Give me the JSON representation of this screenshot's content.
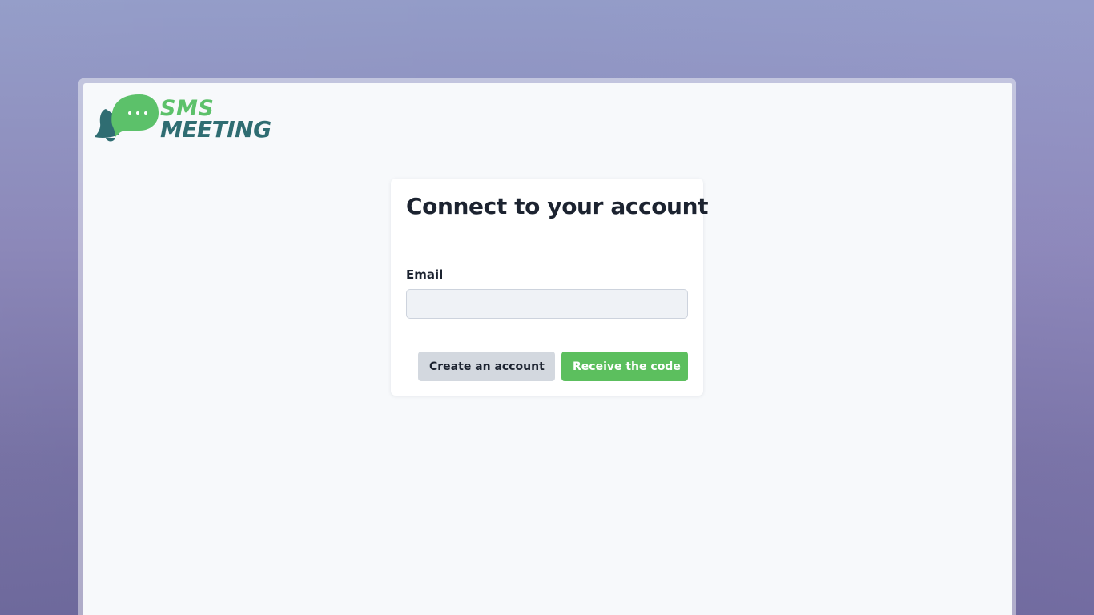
{
  "logo": {
    "line1": "SMS",
    "line2": "MEETING",
    "icon": "speech-bubble-bell-icon",
    "colors": {
      "green": "#5cc16a",
      "teal": "#2f6d72"
    }
  },
  "login_card": {
    "title": "Connect to your account",
    "email_label": "Email",
    "email_value": "",
    "email_placeholder": "",
    "create_account_label": "Create an account",
    "receive_code_label": "Receive the code"
  },
  "colors": {
    "primary_button": "#5cbf5e",
    "secondary_button": "#d3d8df",
    "page_background": "#f7f9fb",
    "backdrop": "#8a86b8"
  }
}
